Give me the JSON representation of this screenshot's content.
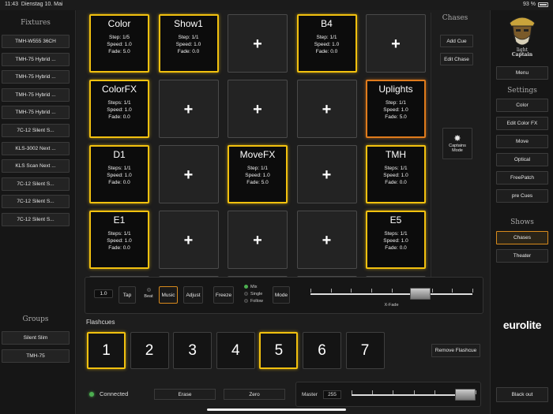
{
  "status": {
    "time": "11:43",
    "date": "Dienstag 10. Mai",
    "battery": "93 %"
  },
  "fixtures": {
    "title": "Fixtures",
    "items": [
      "TMH-W555 36CH",
      "TMH-75 Hybrid ...",
      "TMH-75 Hybrid ...",
      "TMH-75 Hybrid ...",
      "TMH-75 Hybrid ...",
      "7C-12 Silent S...",
      "KLS-3002 Next ...",
      "KLS Scan Next ...",
      "7C-12 Silent S...",
      "7C-12 Silent S...",
      "7C-12 Silent S..."
    ]
  },
  "groups": {
    "title": "Groups",
    "items": [
      "Silent Slim",
      "TMH-75"
    ]
  },
  "cues": [
    {
      "name": "Color",
      "steps": "Step: 1/5",
      "speed": "Speed: 1.0",
      "fade": "Fade: 5.0",
      "state": "yellow"
    },
    {
      "name": "Show1",
      "steps": "Step: 1/1",
      "speed": "Speed: 1.0",
      "fade": "Fade: 0.0",
      "state": "yellow"
    },
    {
      "name": "",
      "state": "empty"
    },
    {
      "name": "B4",
      "steps": "Step: 1/1",
      "speed": "Speed: 1.0",
      "fade": "Fade: 0.0",
      "state": "yellow"
    },
    {
      "name": "",
      "state": "empty"
    },
    {
      "name": "ColorFX",
      "steps": "Steps: 1/1",
      "speed": "Speed: 1.0",
      "fade": "Fade: 0.0",
      "state": "yellow"
    },
    {
      "name": "",
      "state": "empty"
    },
    {
      "name": "",
      "state": "empty"
    },
    {
      "name": "",
      "state": "empty"
    },
    {
      "name": "Uplights",
      "steps": "Step: 1/1",
      "speed": "Speed: 1.0",
      "fade": "Fade: 5.0",
      "state": "orange"
    },
    {
      "name": "D1",
      "steps": "Steps: 1/1",
      "speed": "Speed: 1.0",
      "fade": "Fade: 0.0",
      "state": "yellow"
    },
    {
      "name": "",
      "state": "empty"
    },
    {
      "name": "MoveFX",
      "steps": "Step: 1/1",
      "speed": "Speed: 1.0",
      "fade": "Fade: 5.0",
      "state": "yellow"
    },
    {
      "name": "",
      "state": "empty"
    },
    {
      "name": "TMH",
      "steps": "Steps: 1/1",
      "speed": "Speed: 1.0",
      "fade": "Fade: 0.0",
      "state": "yellow"
    },
    {
      "name": "E1",
      "steps": "Steps: 1/1",
      "speed": "Speed: 1.0",
      "fade": "Fade: 0.0",
      "state": "yellow"
    },
    {
      "name": "",
      "state": "empty"
    },
    {
      "name": "",
      "state": "empty"
    },
    {
      "name": "",
      "state": "empty"
    },
    {
      "name": "E5",
      "steps": "Steps: 1/1",
      "speed": "Speed: 1.0",
      "fade": "Fade: 0.0",
      "state": "yellow"
    }
  ],
  "plus_symbol": "+",
  "chases": {
    "title": "Chases",
    "add_cue": "Add Cue",
    "edit_chase": "Edit Chase",
    "captains_mode": "Captains Mode"
  },
  "controls": {
    "bpm": "1.0",
    "tap": "Tap",
    "beat": "Beat",
    "music": "Music",
    "adjust": "Adjust",
    "freeze": "Freeze",
    "modes": [
      "Mix",
      "Single",
      "Follow"
    ],
    "mode": "Mode",
    "xfade": "X-Fade",
    "xfade_level": 0.74
  },
  "flashcues": {
    "title": "Flashcues",
    "items": [
      "1",
      "2",
      "3",
      "4",
      "5",
      "6",
      "7"
    ],
    "active_indices": [
      0,
      4
    ],
    "remove": "Remove Flashcue"
  },
  "footer": {
    "connected": "Connected",
    "erase": "Erase",
    "zero": "Zero",
    "master_label": "Master",
    "master_value": "255",
    "master_level": 1.0
  },
  "logo": {
    "text_line1": "light",
    "text_line2": "Captain"
  },
  "right": {
    "menu": "Menu",
    "settings_title": "Settings",
    "settings": [
      "Color",
      "Edit Color FX",
      "Move",
      "Optical",
      "FreePatch",
      "pre Cues"
    ],
    "shows_title": "Shows",
    "shows": [
      "Chases",
      "Theater"
    ],
    "active_show": "Chases",
    "brand": "eurolite",
    "blackout": "Black out"
  },
  "colors": {
    "yellow": "#f2c10f",
    "orange": "#e07b1c",
    "green": "#4caf50"
  }
}
